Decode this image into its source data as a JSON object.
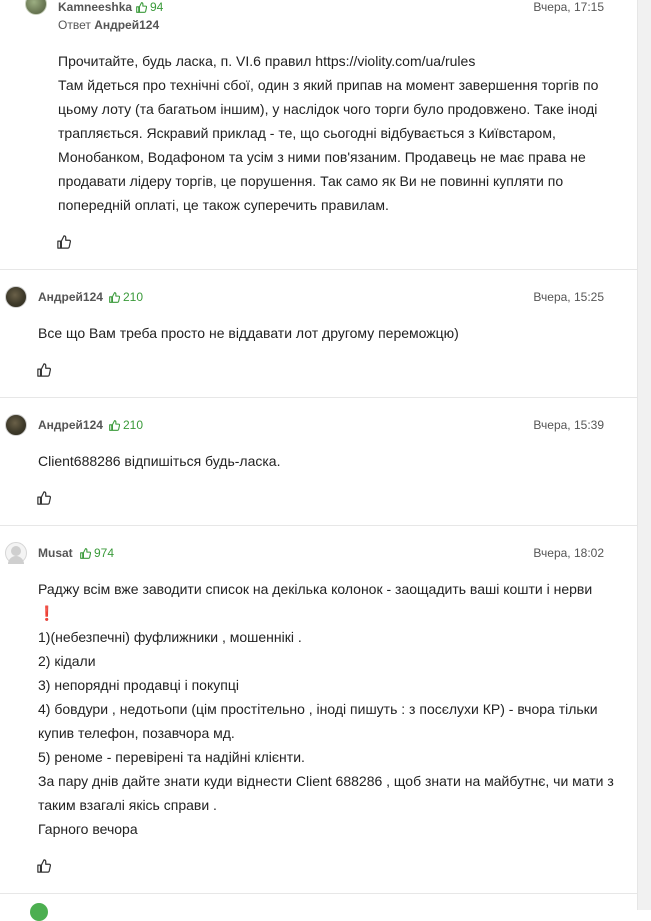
{
  "colors": {
    "accent_green": "#3a9a3a",
    "text": "#222222",
    "meta": "#555555",
    "divider": "#e7e7e7"
  },
  "comments": [
    {
      "author": "Kamneeshka",
      "rating": "94",
      "time": "Вчера, 17:15",
      "reply_prefix": "Ответ",
      "reply_to": "Андрей124",
      "lines": [
        "Прочитайте, будь ласка, п. VI.6 правил https://violity.com/ua/rules",
        "Там йдеться про технічні сбої, один з який припав на момент завершення торгів по",
        "цьому лоту (та багатьом іншим), у наслідок чого торги було продовжено. Таке іноді",
        "трапляється. Яскравий приклад - те, що сьогодні відбувається з Київстаром,",
        "Монобанком, Водафоном та усім з ними пов'язаним. Продавець не має права не",
        "продавати лідеру торгів, це порушення. Так само як Ви не повинні купляти по",
        "попередній оплаті, це також суперечить правилам."
      ]
    },
    {
      "author": "Андрей124",
      "rating": "210",
      "time": "Вчера, 15:25",
      "lines": [
        "Все що Вам треба просто не віддавати лот другому переможцю)"
      ]
    },
    {
      "author": "Андрей124",
      "rating": "210",
      "time": "Вчера, 15:39",
      "lines": [
        "Client688286 відпишіться будь-ласка."
      ]
    },
    {
      "author": "Musat",
      "rating": "974",
      "time": "Вчера, 18:02",
      "lines": [
        "Раджу всім вже заводити список на декілька колонок -  заощадить ваші кошти і нерви",
        "❗",
        "1)(небезпечні) фуфлижники , мошеннікі .",
        "2) кідали",
        "3) непорядні продавці і покупці",
        "4) бовдури , недотьопи (цім простітельно , іноді пишуть : з посєлухи КР) - вчора тільки",
        "купив телефон, позавчора мд.",
        "5) реноме - перевірені та надійні клієнти.",
        "За пару днів дайте знати куди віднести Client 688286 , щоб знати на майбутнє, чи мати з",
        "таким взагалі якісь справи .",
        "Гарного вечора"
      ]
    }
  ],
  "icons": {
    "rating": "thumbs-up-icon",
    "like": "thumbs-up-outline-icon"
  }
}
